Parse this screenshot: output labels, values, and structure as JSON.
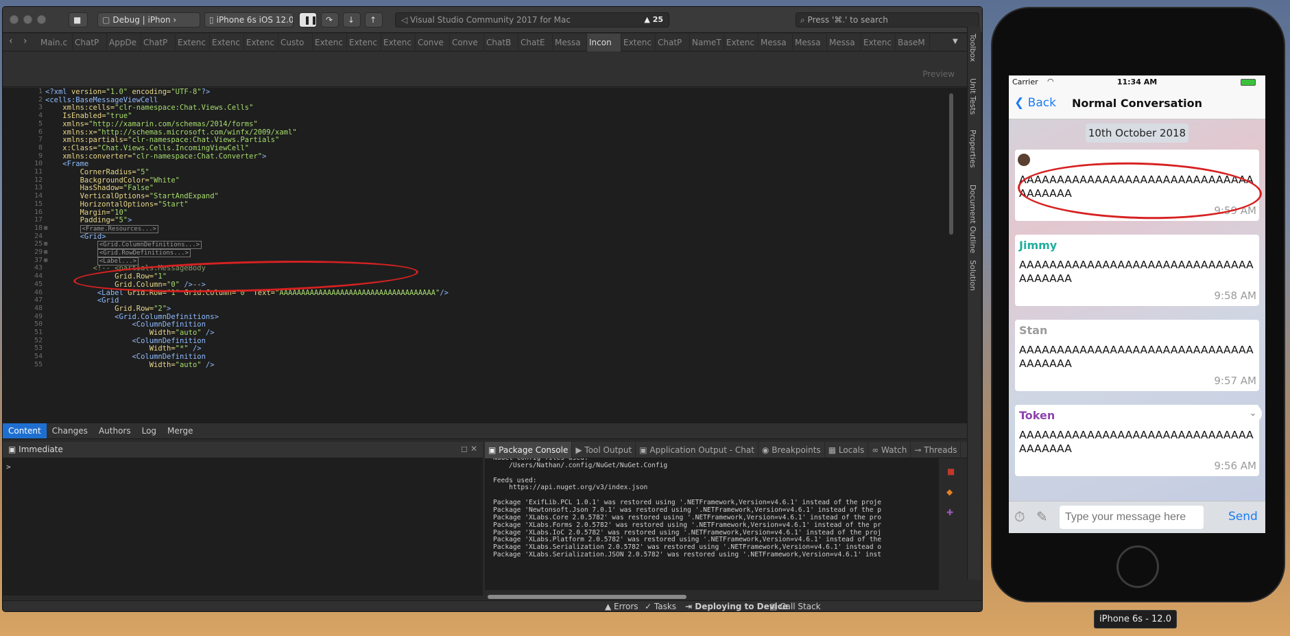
{
  "ide": {
    "run_config": "Debug | iPhon",
    "device": "iPhone 6s iOS 12.0",
    "status_text": "Visual Studio Community 2017 for Mac",
    "warning_count": "25",
    "search_placeholder": "Press '⌘.' to search",
    "tabs": [
      "Main.c",
      "ChatP",
      "AppDe",
      "ChatP",
      "Extenc",
      "Extenc",
      "Extenc",
      "Custo",
      "Extenc",
      "Extenc",
      "Extenc",
      "Conve",
      "Conve",
      "ChatB",
      "ChatE",
      "Messa",
      "Incon",
      "Extenc",
      "ChatP",
      "NameT",
      "Extenc",
      "Messa",
      "Messa",
      "Messa",
      "Extenc",
      "BaseM"
    ],
    "active_tab_index": 16,
    "preview_label": "Preview",
    "side_panels": [
      "Toolbox",
      "Unit Tests",
      "Properties",
      "Document Outline",
      "Solution"
    ],
    "version_tabs": [
      "Content",
      "Changes",
      "Authors",
      "Log",
      "Merge"
    ],
    "immediate_title": "Immediate",
    "immediate_prompt": ">",
    "pad_tabs": [
      "Package Console",
      "Tool Output",
      "Application Output - Chat",
      "Breakpoints",
      "Locals",
      "Watch",
      "Threads"
    ],
    "status_items": [
      "Errors",
      "Tasks",
      "Deploying to Device",
      "Call Stack"
    ]
  },
  "editor": {
    "line_numbers": [
      "1",
      "2",
      "3",
      "4",
      "5",
      "6",
      "7",
      "8",
      "9",
      "10",
      "11",
      "12",
      "13",
      "14",
      "15",
      "16",
      "17",
      "18",
      "24",
      "25",
      "29",
      "37",
      "43",
      "44",
      "45",
      "46",
      "47",
      "48",
      "49",
      "50",
      "51",
      "52",
      "53",
      "54",
      "55"
    ],
    "lines": [
      "<?xml version=\"1.0\" encoding=\"UTF-8\"?>",
      "<cells:BaseMessageViewCell",
      "    xmlns:cells=\"clr-namespace:Chat.Views.Cells\"",
      "    IsEnabled=\"true\"",
      "    xmlns=\"http://xamarin.com/schemas/2014/forms\"",
      "    xmlns:x=\"http://schemas.microsoft.com/winfx/2009/xaml\"",
      "    xmlns:partials=\"clr-namespace:Chat.Views.Partials\"",
      "    x:Class=\"Chat.Views.Cells.IncomingViewCell\"",
      "    xmlns:converter=\"clr-namespace:Chat.Converter\">",
      "    <Frame",
      "        CornerRadius=\"5\"",
      "        BackgroundColor=\"White\"",
      "        HasShadow=\"False\"",
      "        VerticalOptions=\"StartAndExpand\"",
      "        HorizontalOptions=\"Start\"",
      "        Margin=\"10\"",
      "        Padding=\"5\">",
      "        <Frame.Resources...>",
      "        <Grid>",
      "            <Grid.ColumnDefinitions...>",
      "            <Grid.RowDefinitions...>",
      "            <Label...>",
      "           <!-- <partials:MessageBody",
      "                Grid.Row=\"1\"",
      "                Grid.Column=\"0\" />-->",
      "            <Label Grid.Row=\"1\" Grid.Column=\"0\" Text=\"AAAAAAAAAAAAAAAAAAAAAAAAAAAAAAAAAAAA\"/>",
      "            <Grid",
      "                Grid.Row=\"2\">",
      "                <Grid.ColumnDefinitions>",
      "                    <ColumnDefinition",
      "                        Width=\"auto\" />",
      "                    <ColumnDefinition",
      "                        Width=\"*\" />",
      "                    <ColumnDefinition",
      "                        Width=\"auto\" />"
    ]
  },
  "console": {
    "lines": [
      "NuGet Config files used:",
      "    /Users/Nathan/.config/NuGet/NuGet.Config",
      "",
      "Feeds used:",
      "    https://api.nuget.org/v3/index.json",
      "",
      "Package 'ExifLib.PCL 1.0.1' was restored using '.NETFramework,Version=v4.6.1' instead of the proje",
      "Package 'Newtonsoft.Json 7.0.1' was restored using '.NETFramework,Version=v4.6.1' instead of the p",
      "Package 'XLabs.Core 2.0.5782' was restored using '.NETFramework,Version=v4.6.1' instead of the pro",
      "Package 'XLabs.Forms 2.0.5782' was restored using '.NETFramework,Version=v4.6.1' instead of the pr",
      "Package 'XLabs.IoC 2.0.5782' was restored using '.NETFramework,Version=v4.6.1' instead of the proj",
      "Package 'XLabs.Platform 2.0.5782' was restored using '.NETFramework,Version=v4.6.1' instead of the",
      "Package 'XLabs.Serialization 2.0.5782' was restored using '.NETFramework,Version=v4.6.1' instead o",
      "Package 'XLabs.Serialization.JSON 2.0.5782' was restored using '.NETFramework,Version=v4.6.1' inst"
    ]
  },
  "phone": {
    "carrier": "Carrier",
    "time": "11:34 AM",
    "back_label": "Back",
    "title": "Normal Conversation",
    "date_chip": "10th October 2018",
    "messages": [
      {
        "name": "",
        "text": "AAAAAAAAAAAAAAAAAAAAAAAAAAAAAAAAAAAAAA",
        "time": "9:59 AM",
        "name_color": "#000000"
      },
      {
        "name": "Jimmy",
        "text": "AAAAAAAAAAAAAAAAAAAAAAAAAAAAAAAAAAAAAA",
        "time": "9:58 AM",
        "name_color": "#1fae9c"
      },
      {
        "name": "Stan",
        "text": "AAAAAAAAAAAAAAAAAAAAAAAAAAAAAAAAAAAAAA",
        "time": "9:57 AM",
        "name_color": "#9b9b9b"
      },
      {
        "name": "Token",
        "text": "AAAAAAAAAAAAAAAAAAAAAAAAAAAAAAAAAAAAAA",
        "time": "9:56 AM",
        "name_color": "#8e44ad"
      }
    ],
    "input_placeholder": "Type your message here",
    "send_label": "Send",
    "simulator_label": "iPhone 6s - 12.0"
  },
  "colors": {
    "annotation": "#d72121",
    "accent": "#1a7cf5",
    "tag": "#8fbcff",
    "attr": "#e8d78a",
    "string": "#a7dd6e",
    "comment": "#8a9a6a"
  }
}
